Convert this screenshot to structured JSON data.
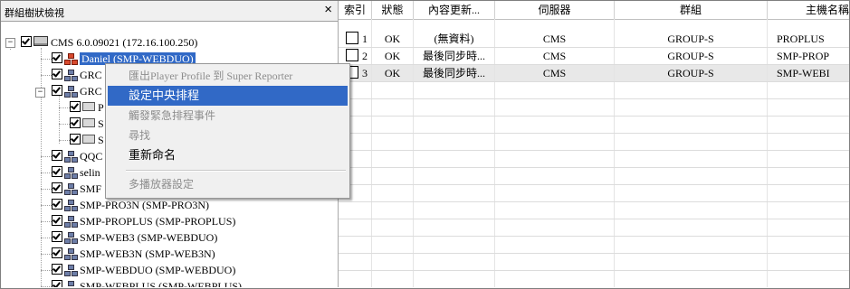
{
  "panel": {
    "title": "群組樹狀檢視",
    "close_glyph": "×"
  },
  "tree": {
    "root": {
      "expander": "−",
      "label": "CMS  6.0.09021  (172.16.100.250)",
      "icon": "cms-icon"
    },
    "items": [
      {
        "label": "Daniel  (SMP-WEBDUO)",
        "selected": true,
        "icon": "group-icon-red"
      },
      {
        "label": "GRC",
        "icon": "group-icon"
      },
      {
        "label": "GRC",
        "icon": "group-icon",
        "expander": "−"
      },
      {
        "label": "P",
        "icon": "player-icon"
      },
      {
        "label": "S",
        "icon": "player-icon"
      },
      {
        "label": "S",
        "icon": "player-icon"
      },
      {
        "label": "QQC",
        "icon": "group-icon"
      },
      {
        "label": "selin",
        "icon": "group-icon"
      },
      {
        "label": "SMF",
        "icon": "group-icon"
      },
      {
        "label": "SMP-PRO3N  (SMP-PRO3N)",
        "icon": "group-icon"
      },
      {
        "label": "SMP-PROPLUS  (SMP-PROPLUS)",
        "icon": "group-icon"
      },
      {
        "label": "SMP-WEB3  (SMP-WEBDUO)",
        "icon": "group-icon"
      },
      {
        "label": "SMP-WEB3N  (SMP-WEB3N)",
        "icon": "group-icon"
      },
      {
        "label": "SMP-WEBDUO  (SMP-WEBDUO)",
        "icon": "group-icon"
      },
      {
        "label": "SMP-WEBPLUS  (SMP-WEBPLUS)",
        "icon": "group-icon"
      }
    ]
  },
  "context_menu": {
    "items": [
      {
        "label": "匯出Player Profile 到 Super Reporter",
        "disabled": true
      },
      {
        "label": "設定中央排程",
        "highlighted": true
      },
      {
        "label": "觸發緊急排程事件",
        "disabled": true
      },
      {
        "label": "尋找",
        "disabled": true
      },
      {
        "label": "重新命名"
      },
      {
        "label": "多播放器設定",
        "disabled": true
      }
    ]
  },
  "table": {
    "columns": [
      "索引",
      "狀態",
      "內容更新...",
      "伺服器",
      "群組",
      "主機名稱"
    ],
    "rows": [
      {
        "index": "1",
        "status": "OK",
        "content": "(無資料)",
        "server": "CMS",
        "group": "GROUP-S",
        "host": "PROPLUS"
      },
      {
        "index": "2",
        "status": "OK",
        "content": "最後同步時...",
        "server": "CMS",
        "group": "GROUP-S",
        "host": "SMP-PROP"
      },
      {
        "index": "3",
        "status": "OK",
        "content": "最後同步時...",
        "server": "CMS",
        "group": "GROUP-S",
        "host": "SMP-WEBI"
      }
    ],
    "highlighted_row": 2
  },
  "colors": {
    "selection": "#3169c6",
    "menu_bg": "#f0f0f0",
    "disabled_text": "#8d8d8d"
  }
}
